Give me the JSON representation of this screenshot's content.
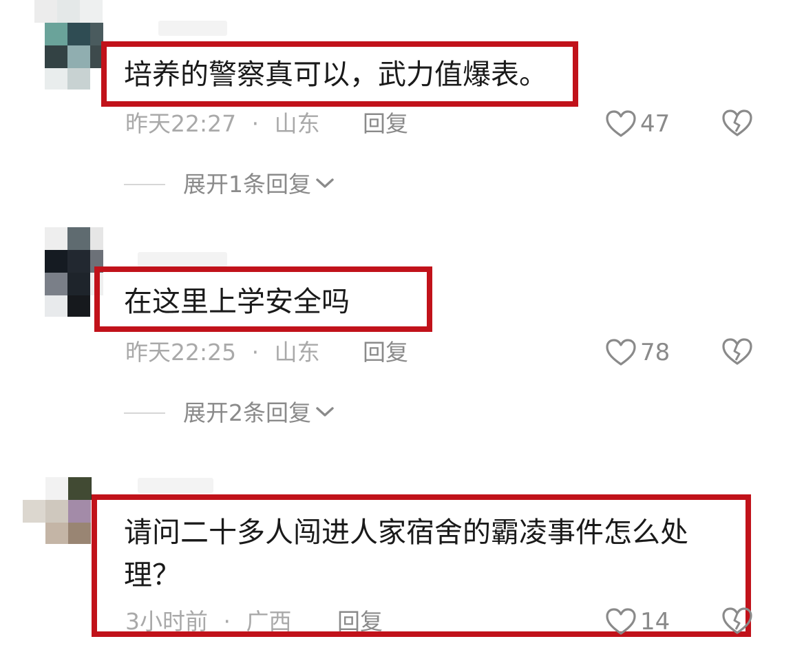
{
  "comments": [
    {
      "text": "培养的警察真可以，武力值爆表。",
      "time": "昨天22:27",
      "location": "山东",
      "reply_label": "回复",
      "likes": "47",
      "expand_label": "展开1条回复"
    },
    {
      "text": "在这里上学安全吗",
      "time": "昨天22:25",
      "location": "山东",
      "reply_label": "回复",
      "likes": "78",
      "expand_label": "展开2条回复"
    },
    {
      "text_line1": "请问二十多人闯进人家宿舍的霸凌事件怎么处",
      "text_line2": "理？",
      "time": "3小时前",
      "location": "广西",
      "reply_label": "回复",
      "likes": "14"
    }
  ],
  "meta_separator": "·",
  "icons": {
    "like": "heart-outline-icon",
    "dislike": "broken-heart-icon",
    "expand": "chevron-down-icon"
  },
  "colors": {
    "highlight_border": "#c1121a",
    "meta_text": "#a9a9a9",
    "secondary_text": "#8a8a8a"
  }
}
